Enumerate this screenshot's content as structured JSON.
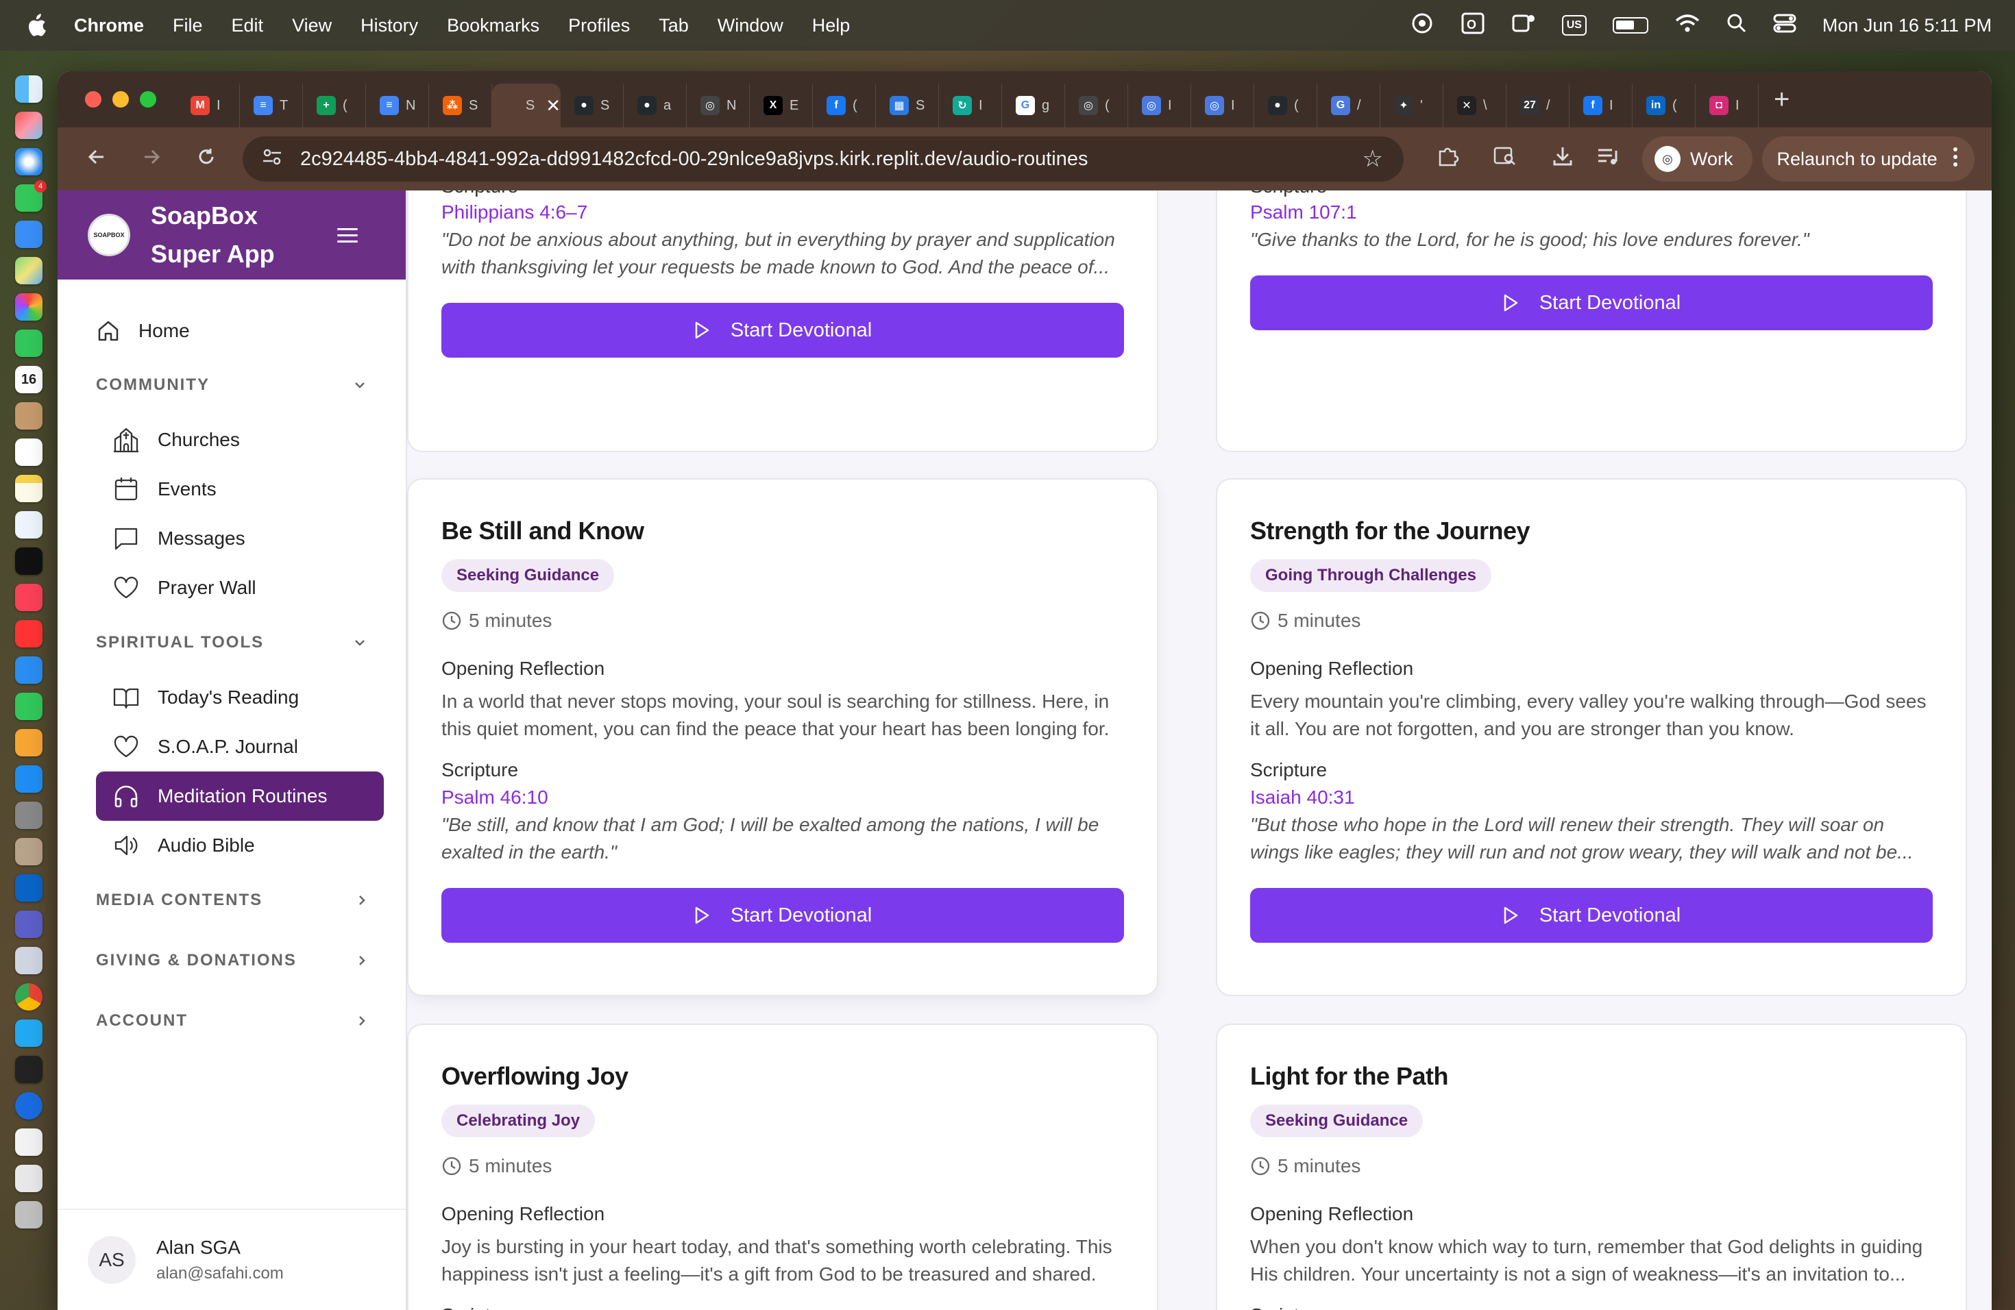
{
  "menubar": {
    "app": "Chrome",
    "items": [
      "File",
      "Edit",
      "View",
      "History",
      "Bookmarks",
      "Profiles",
      "Tab",
      "Window",
      "Help"
    ],
    "input_source": "US",
    "datetime": "Mon Jun 16  5:11 PM"
  },
  "dock": {
    "calendar_day": "16",
    "messages_badge": "4"
  },
  "browser": {
    "tabs": [
      {
        "icon": "gmail-icon",
        "title": "I",
        "color": "#ea4335",
        "glyph": "M"
      },
      {
        "icon": "docs-icon",
        "title": "T",
        "color": "#4285f4",
        "glyph": "≡"
      },
      {
        "icon": "sheets-icon",
        "title": "(",
        "color": "#0f9d58",
        "glyph": "+"
      },
      {
        "icon": "docs-icon",
        "title": "N",
        "color": "#4285f4",
        "glyph": "≡"
      },
      {
        "icon": "replit-icon",
        "title": "S",
        "color": "#f26207",
        "glyph": "⁂"
      },
      {
        "icon": "soapbox-icon",
        "title": "S",
        "color": "#5a4034",
        "glyph": "",
        "active": true
      },
      {
        "icon": "github-icon",
        "title": "S",
        "color": "#24292e",
        "glyph": "●"
      },
      {
        "icon": "github-icon",
        "title": "a",
        "color": "#24292e",
        "glyph": "●"
      },
      {
        "icon": "openai-icon",
        "title": "N",
        "color": "#444",
        "glyph": "◎"
      },
      {
        "icon": "x-icon",
        "title": "E",
        "color": "#000",
        "glyph": "X"
      },
      {
        "icon": "facebook-icon",
        "title": "(",
        "color": "#1877f2",
        "glyph": "f"
      },
      {
        "icon": "puzzle-icon",
        "title": "S",
        "color": "#2a7ae2",
        "glyph": "▦"
      },
      {
        "icon": "refresh-icon",
        "title": "I",
        "color": "#1a9",
        "glyph": "↻"
      },
      {
        "icon": "google-icon",
        "title": "g",
        "color": "#fff",
        "glyph": "G"
      },
      {
        "icon": "openai-icon",
        "title": "(",
        "color": "#444",
        "glyph": "◎"
      },
      {
        "icon": "web-icon",
        "title": "I",
        "color": "#4a7adf",
        "glyph": "◎"
      },
      {
        "icon": "web-icon",
        "title": "I",
        "color": "#4a7adf",
        "glyph": "◎"
      },
      {
        "icon": "github-icon",
        "title": "(",
        "color": "#24292e",
        "glyph": "●"
      },
      {
        "icon": "g-icon",
        "title": "/",
        "color": "#4a7adf",
        "glyph": "G"
      },
      {
        "icon": "leaf-icon",
        "title": "'",
        "color": "#333",
        "glyph": "✦"
      },
      {
        "icon": "crossed-icon",
        "title": "\\",
        "color": "#222",
        "glyph": "✕"
      },
      {
        "icon": "calendar-icon",
        "title": "/",
        "color": "#333",
        "glyph": "27"
      },
      {
        "icon": "facebook-icon",
        "title": "I",
        "color": "#1877f2",
        "glyph": "f"
      },
      {
        "icon": "linkedin-icon",
        "title": "(",
        "color": "#0a66c2",
        "glyph": "in"
      },
      {
        "icon": "instagram-icon",
        "title": "I",
        "color": "#d62976",
        "glyph": "◘"
      }
    ],
    "url": "2c924485-4bb4-4841-992a-dd991482cfcd-00-29nlce9a8jvps.kirk.replit.dev/audio-routines",
    "profile_label": "Work",
    "relaunch_label": "Relaunch to update"
  },
  "sidebar": {
    "brand_line1": "SoapBox",
    "brand_line2": "Super App",
    "logo_text": "SOAPBOX",
    "home": "Home",
    "sections": [
      {
        "label": "COMMUNITY",
        "expanded": true,
        "items": [
          "Churches",
          "Events",
          "Messages",
          "Prayer Wall"
        ]
      },
      {
        "label": "SPIRITUAL TOOLS",
        "expanded": true,
        "items": [
          "Today's Reading",
          "S.O.A.P. Journal",
          "Meditation Routines",
          "Audio Bible"
        ]
      },
      {
        "label": "MEDIA CONTENTS",
        "expanded": false
      },
      {
        "label": "GIVING & DONATIONS",
        "expanded": false
      },
      {
        "label": "ACCOUNT",
        "expanded": false
      }
    ],
    "user": {
      "initials": "AS",
      "name": "Alan SGA",
      "email": "alan@safahi.com"
    }
  },
  "cards": {
    "top_left": {
      "scripture_label": "Scripture",
      "reference": "Philippians 4:6–7",
      "verse": "\"Do not be anxious about anything, but in everything by prayer and supplication with thanksgiving let your requests be made known to God. And the peace of...",
      "button": "Start Devotional"
    },
    "top_right": {
      "scripture_label": "Scripture",
      "reference": "Psalm 107:1",
      "verse": "\"Give thanks to the Lord, for he is good; his love endures forever.\"",
      "button": "Start Devotional"
    },
    "mid_left": {
      "title": "Be Still and Know",
      "tag": "Seeking Guidance",
      "duration": "5 minutes",
      "reflection_label": "Opening Reflection",
      "reflection": "In a world that never stops moving, your soul is searching for stillness. Here, in this quiet moment, you can find the peace that your heart has been longing for.",
      "scripture_label": "Scripture",
      "reference": "Psalm 46:10",
      "verse": "\"Be still, and know that I am God; I will be exalted among the nations, I will be exalted in the earth.\"",
      "button": "Start Devotional"
    },
    "mid_right": {
      "title": "Strength for the Journey",
      "tag": "Going Through Challenges",
      "duration": "5 minutes",
      "reflection_label": "Opening Reflection",
      "reflection": "Every mountain you're climbing, every valley you're walking through—God sees it all. You are not forgotten, and you are stronger than you know.",
      "scripture_label": "Scripture",
      "reference": "Isaiah 40:31",
      "verse": "\"But those who hope in the Lord will renew their strength. They will soar on wings like eagles; they will run and not grow weary, they will walk and not be...",
      "button": "Start Devotional"
    },
    "bot_left": {
      "title": "Overflowing Joy",
      "tag": "Celebrating Joy",
      "duration": "5 minutes",
      "reflection_label": "Opening Reflection",
      "reflection": "Joy is bursting in your heart today, and that's something worth celebrating. This happiness isn't just a feeling—it's a gift from God to be treasured and shared.",
      "scripture_label": "Scripture"
    },
    "bot_right": {
      "title": "Light for the Path",
      "tag": "Seeking Guidance",
      "duration": "5 minutes",
      "reflection_label": "Opening Reflection",
      "reflection": "When you don't know which way to turn, remember that God delights in guiding His children. Your uncertainty is not a sign of weakness—it's an invitation to...",
      "scripture_label": "Scripture"
    }
  },
  "colors": {
    "brand": "#6b2f86",
    "active_nav": "#5e2378",
    "button": "#7c3aed",
    "reference": "#8a2be2",
    "tag_bg": "#f1eaf6"
  }
}
